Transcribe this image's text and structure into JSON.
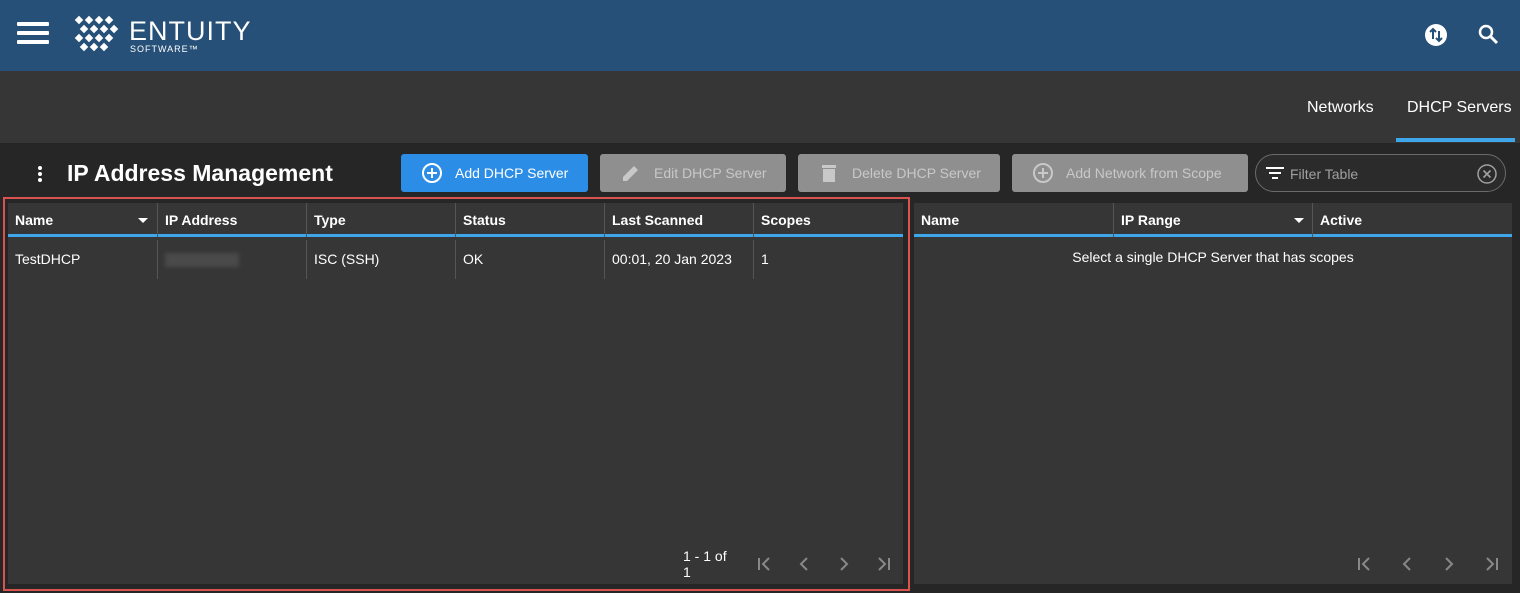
{
  "app": {
    "brand": "ENTUITY",
    "brand_sub": "SOFTWARE™"
  },
  "subnav": {
    "tabs": [
      {
        "label": "Networks"
      },
      {
        "label": "DHCP Servers",
        "active": true
      }
    ]
  },
  "toolbar": {
    "title": "IP Address Management",
    "add_label": "Add DHCP Server",
    "edit_label": "Edit DHCP Server",
    "delete_label": "Delete DHCP Server",
    "add_network_label": "Add Network from Scope",
    "filter_placeholder": "Filter Table"
  },
  "servers_table": {
    "columns": [
      "Name",
      "IP Address",
      "Type",
      "Status",
      "Last Scanned",
      "Scopes"
    ],
    "rows": [
      {
        "name": "TestDHCP",
        "ip": "",
        "type": "ISC (SSH)",
        "status": "OK",
        "last_scanned": "00:01, 20 Jan 2023",
        "scopes": "1"
      }
    ],
    "pager": "1 - 1 of 1"
  },
  "scopes_table": {
    "columns": [
      "Name",
      "IP Range",
      "Active"
    ],
    "empty_message": "Select a single DHCP Server that has scopes"
  },
  "colors": {
    "header": "#265077",
    "accent": "#3ea6e9",
    "primary_button": "#2c8de6",
    "highlight": "#d9534f"
  },
  "icons": [
    "menu-icon",
    "entuity-logo-icon",
    "sync-icon",
    "search-icon",
    "kebab-menu-icon",
    "add-circle-icon",
    "edit-icon",
    "delete-icon",
    "filter-icon",
    "clear-icon",
    "first-page-icon",
    "previous-page-icon",
    "next-page-icon",
    "last-page-icon"
  ]
}
